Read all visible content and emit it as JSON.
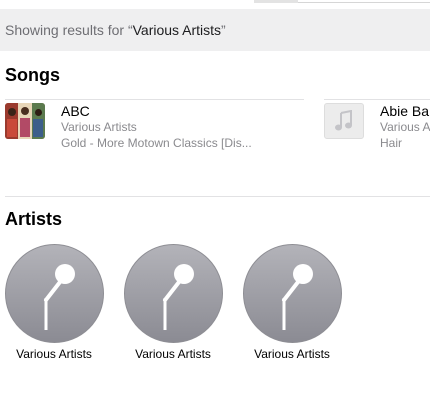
{
  "search": {
    "prefix": "Showing results for “",
    "query": "Various Artists",
    "suffix": "”"
  },
  "songs": {
    "title": "Songs",
    "items": [
      {
        "title": "ABC",
        "artist": "Various Artists",
        "album": "Gold - More Motown Classics [Dis..."
      },
      {
        "title": "Abie Ba",
        "artist": "Various A",
        "album": "Hair"
      }
    ]
  },
  "artists": {
    "title": "Artists",
    "items": [
      {
        "name": "Various Artists"
      },
      {
        "name": "Various Artists"
      },
      {
        "name": "Various Artists"
      }
    ]
  },
  "icons": {
    "artist_placeholder": "microphone-icon",
    "song_placeholder": "music-note-icon"
  }
}
